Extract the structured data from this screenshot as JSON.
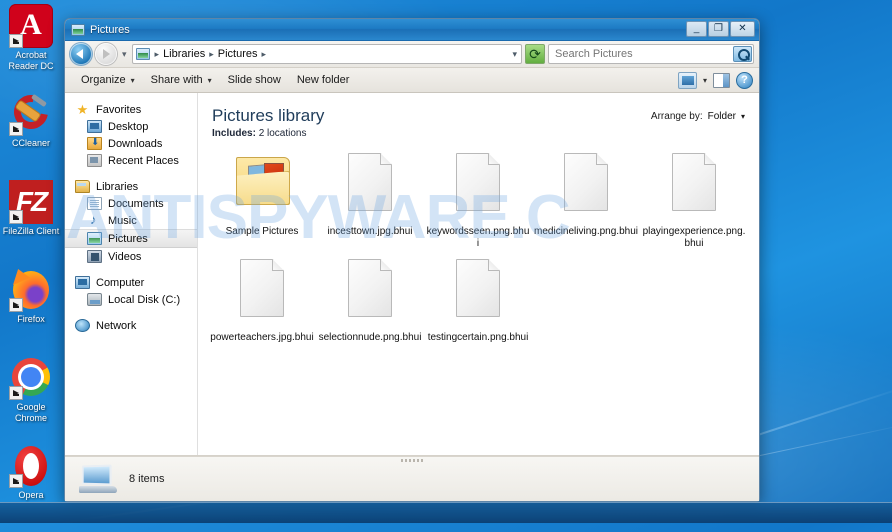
{
  "desktop": {
    "icons": [
      {
        "label": "Acrobat Reader DC",
        "icon": "acrobat-reader-icon"
      },
      {
        "label": "CCleaner",
        "icon": "ccleaner-icon"
      },
      {
        "label": "FileZilla Client",
        "icon": "filezilla-icon"
      },
      {
        "label": "Firefox",
        "icon": "firefox-icon"
      },
      {
        "label": "Google Chrome",
        "icon": "chrome-icon"
      },
      {
        "label": "Opera",
        "icon": "opera-icon"
      }
    ],
    "watermark": "ANTISPYWARE.C"
  },
  "window": {
    "title": "Pictures",
    "controls": {
      "minimize": "_",
      "maximize": "❐",
      "close": "✕"
    },
    "address": {
      "crumbs": [
        "Libraries",
        "Pictures"
      ],
      "separator": "▸",
      "dropdown_caret": "▾"
    },
    "search": {
      "placeholder": "Search Pictures",
      "value": ""
    },
    "toolbar": {
      "organize": "Organize",
      "share_with": "Share with",
      "slide_show": "Slide show",
      "new_folder": "New folder",
      "caret": "▾"
    }
  },
  "navpane": {
    "groups": [
      {
        "root": {
          "label": "Favorites",
          "icon": "star-icon"
        },
        "items": [
          {
            "label": "Desktop",
            "icon": "desktop-icon"
          },
          {
            "label": "Downloads",
            "icon": "downloads-icon"
          },
          {
            "label": "Recent Places",
            "icon": "recent-places-icon"
          }
        ]
      },
      {
        "root": {
          "label": "Libraries",
          "icon": "libraries-icon"
        },
        "items": [
          {
            "label": "Documents",
            "icon": "documents-icon"
          },
          {
            "label": "Music",
            "icon": "music-icon"
          },
          {
            "label": "Pictures",
            "icon": "pictures-icon",
            "selected": true
          },
          {
            "label": "Videos",
            "icon": "videos-icon"
          }
        ]
      },
      {
        "root": {
          "label": "Computer",
          "icon": "computer-icon"
        },
        "items": [
          {
            "label": "Local Disk (C:)",
            "icon": "local-disk-icon"
          }
        ]
      },
      {
        "root": {
          "label": "Network",
          "icon": "network-icon"
        },
        "items": []
      }
    ]
  },
  "library": {
    "title": "Pictures library",
    "includes_label": "Includes:",
    "includes_value": "2 locations",
    "arrange_label": "Arrange by:",
    "arrange_value": "Folder"
  },
  "files": [
    {
      "name": "Sample Pictures",
      "type": "folder"
    },
    {
      "name": "incesttown.jpg.bhui",
      "type": "file"
    },
    {
      "name": "keywordsseen.png.bhui",
      "type": "file"
    },
    {
      "name": "medicineliving.png.bhui",
      "type": "file"
    },
    {
      "name": "playingexperience.png.bhui",
      "type": "file"
    },
    {
      "name": "powerteachers.jpg.bhui",
      "type": "file"
    },
    {
      "name": "selectionnude.png.bhui",
      "type": "file"
    },
    {
      "name": "testingcertain.png.bhui",
      "type": "file"
    }
  ],
  "status": {
    "item_count": "8 items"
  },
  "colors": {
    "titlebar": "#1d7bc4",
    "desktop": "#1f8ddb",
    "selection": "#e4e4e4",
    "library_title": "#1f3c5a"
  }
}
